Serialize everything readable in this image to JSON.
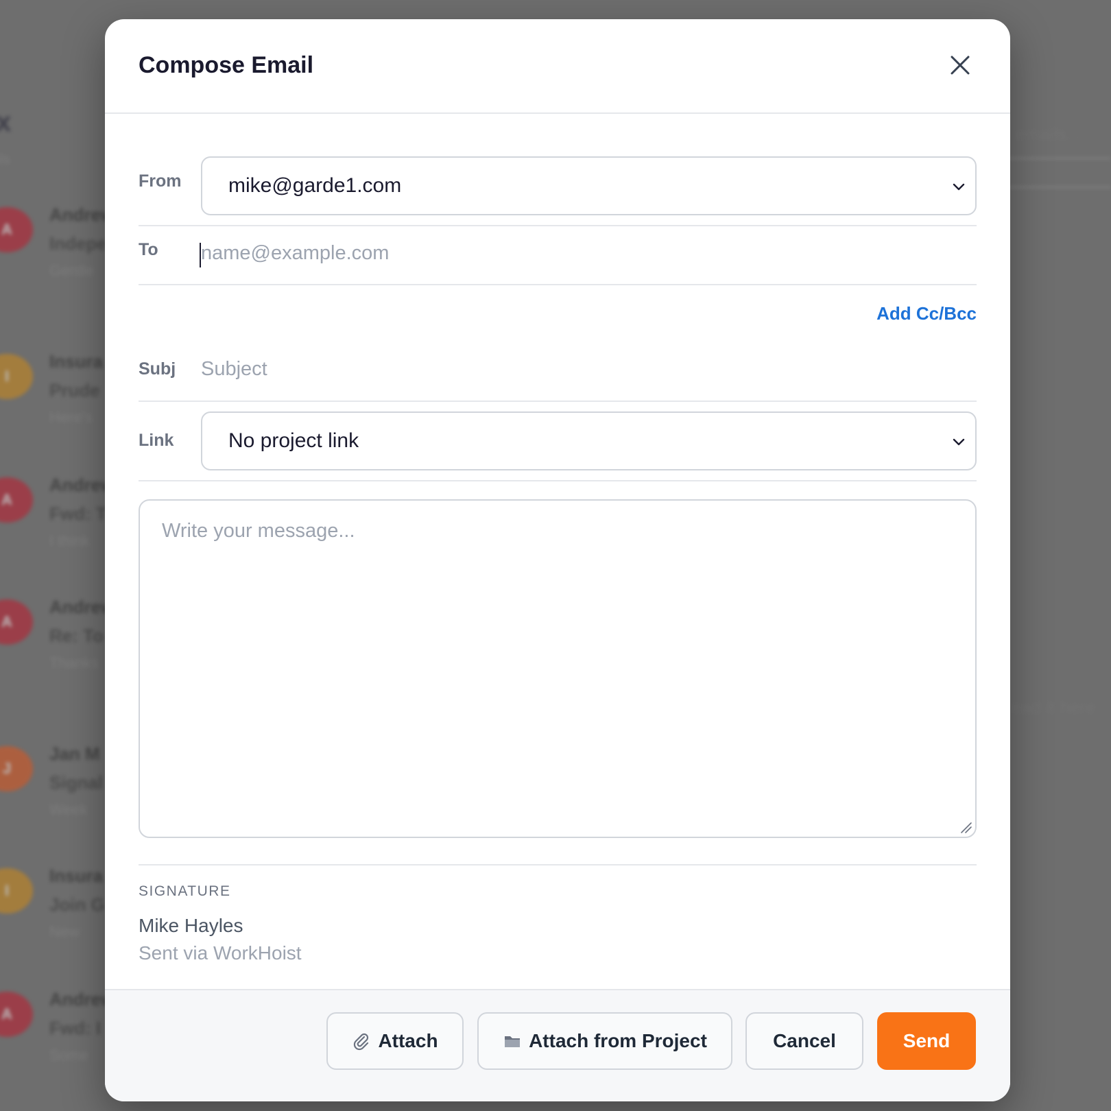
{
  "background": {
    "title": "x",
    "subtitle": "ils",
    "search_hint": "emails...",
    "empty_hint": "read it here",
    "rows": [
      {
        "initial": "A",
        "color": "#c0182b",
        "line1": "Andrew",
        "line2": "Indepe",
        "line3": "Gentle"
      },
      {
        "initial": "I",
        "color": "#d08a16",
        "line1": "Insura",
        "line2": "Prude",
        "line3": "Here's"
      },
      {
        "initial": "A",
        "color": "#c0182b",
        "line1": "Andrew",
        "line2": "Fwd: T",
        "line3": "I think"
      },
      {
        "initial": "A",
        "color": "#c0182b",
        "line1": "Andrew",
        "line2": "Re: To",
        "line3": "Thanks"
      },
      {
        "initial": "J",
        "color": "#e0541a",
        "line1": "Jan M",
        "line2": "Signal",
        "line3": "Week"
      },
      {
        "initial": "I",
        "color": "#d08a16",
        "line1": "Insura",
        "line2": "Join G",
        "line3": "New"
      },
      {
        "initial": "A",
        "color": "#c0182b",
        "line1": "Andrew",
        "line2": "Fwd: I",
        "line3": "Some"
      }
    ]
  },
  "modal": {
    "title": "Compose Email",
    "from": {
      "label": "From",
      "value": "mike@garde1.com"
    },
    "to": {
      "label": "To",
      "placeholder": "name@example.com"
    },
    "add_cc_bcc": "Add Cc/Bcc",
    "subject": {
      "label": "Subj",
      "placeholder": "Subject"
    },
    "link": {
      "label": "Link",
      "value": "No project link"
    },
    "message": {
      "placeholder": "Write your message..."
    },
    "signature": {
      "label": "SIGNATURE",
      "name": "Mike Hayles",
      "via": "Sent via WorkHoist"
    },
    "footer": {
      "attach": "Attach",
      "attach_from_project": "Attach from Project",
      "cancel": "Cancel",
      "send": "Send"
    },
    "colors": {
      "accent": "#f97316",
      "link": "#1d72d8"
    }
  }
}
